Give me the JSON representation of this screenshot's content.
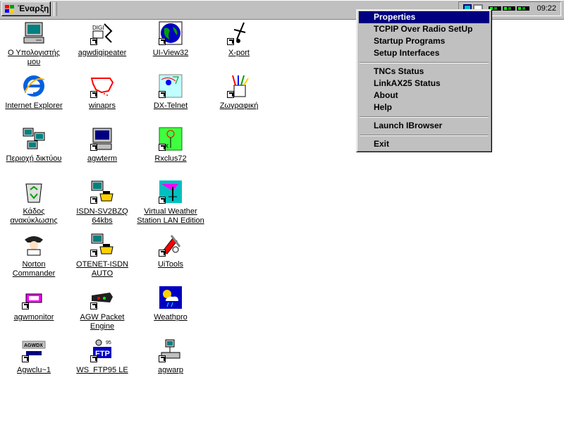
{
  "taskbar": {
    "start_label": "Έναρξη",
    "clock": "09:22"
  },
  "desktop": {
    "icons": [
      {
        "label": "Ο Υπολογιστής\nμου",
        "icon": "my-computer-icon"
      },
      {
        "label": "agwdigipeater",
        "icon": "digipeater-icon"
      },
      {
        "label": "UI-View32",
        "icon": "globe-icon"
      },
      {
        "label": "X-port",
        "icon": "antenna-icon"
      },
      {
        "label": "Internet Explorer",
        "icon": "internet-explorer-icon"
      },
      {
        "label": "winaprs",
        "icon": "usa-map-icon"
      },
      {
        "label": "DX-Telnet",
        "icon": "dx-telnet-icon"
      },
      {
        "label": "Ζωγραφική",
        "icon": "paint-icon"
      },
      {
        "label": "Περιοχή δικτύου",
        "icon": "network-neighborhood-icon"
      },
      {
        "label": "agwterm",
        "icon": "terminal-icon"
      },
      {
        "label": "Rxclus72",
        "icon": "rxclus-icon"
      },
      {
        "label": "Κάδος\nανακύκλωσης",
        "icon": "recycle-bin-icon"
      },
      {
        "label": "ISDN-SV2BZQ\n64kbs",
        "icon": "dialup-icon"
      },
      {
        "label": "Virtual Weather\nStation LAN Edition",
        "icon": "weather-station-icon"
      },
      {
        "label": "Norton Commander",
        "icon": "norton-commander-icon"
      },
      {
        "label": "OTENET-ISDN\nAUTO",
        "icon": "dialup-icon"
      },
      {
        "label": "UiTools",
        "icon": "tools-icon"
      },
      {
        "label": "agwmonitor",
        "icon": "monitor-icon"
      },
      {
        "label": "AGW Packet\nEngine",
        "icon": "packet-engine-icon"
      },
      {
        "label": "Weathpro",
        "icon": "weather-icon"
      },
      {
        "label": "Agwclu~1",
        "icon": "agwdx-icon"
      },
      {
        "label": "WS_FTP95 LE",
        "icon": "ftp-icon"
      },
      {
        "label": "agwarp",
        "icon": "network-computer-icon"
      }
    ]
  },
  "context_menu": {
    "items": [
      {
        "label": "Properties",
        "selected": true
      },
      {
        "label": "TCPIP Over Radio SetUp"
      },
      {
        "label": "Startup Programs"
      },
      {
        "label": "Setup Interfaces"
      },
      {
        "label": "TNCs Status"
      },
      {
        "label": "LinkAX25 Status"
      },
      {
        "label": "About"
      },
      {
        "label": "Help"
      },
      {
        "label": "Launch IBrowser"
      },
      {
        "label": "Exit"
      }
    ]
  },
  "colors": {
    "desktop": "#ffffff",
    "chrome": "#c0c0c0",
    "menu_highlight": "#000080"
  }
}
